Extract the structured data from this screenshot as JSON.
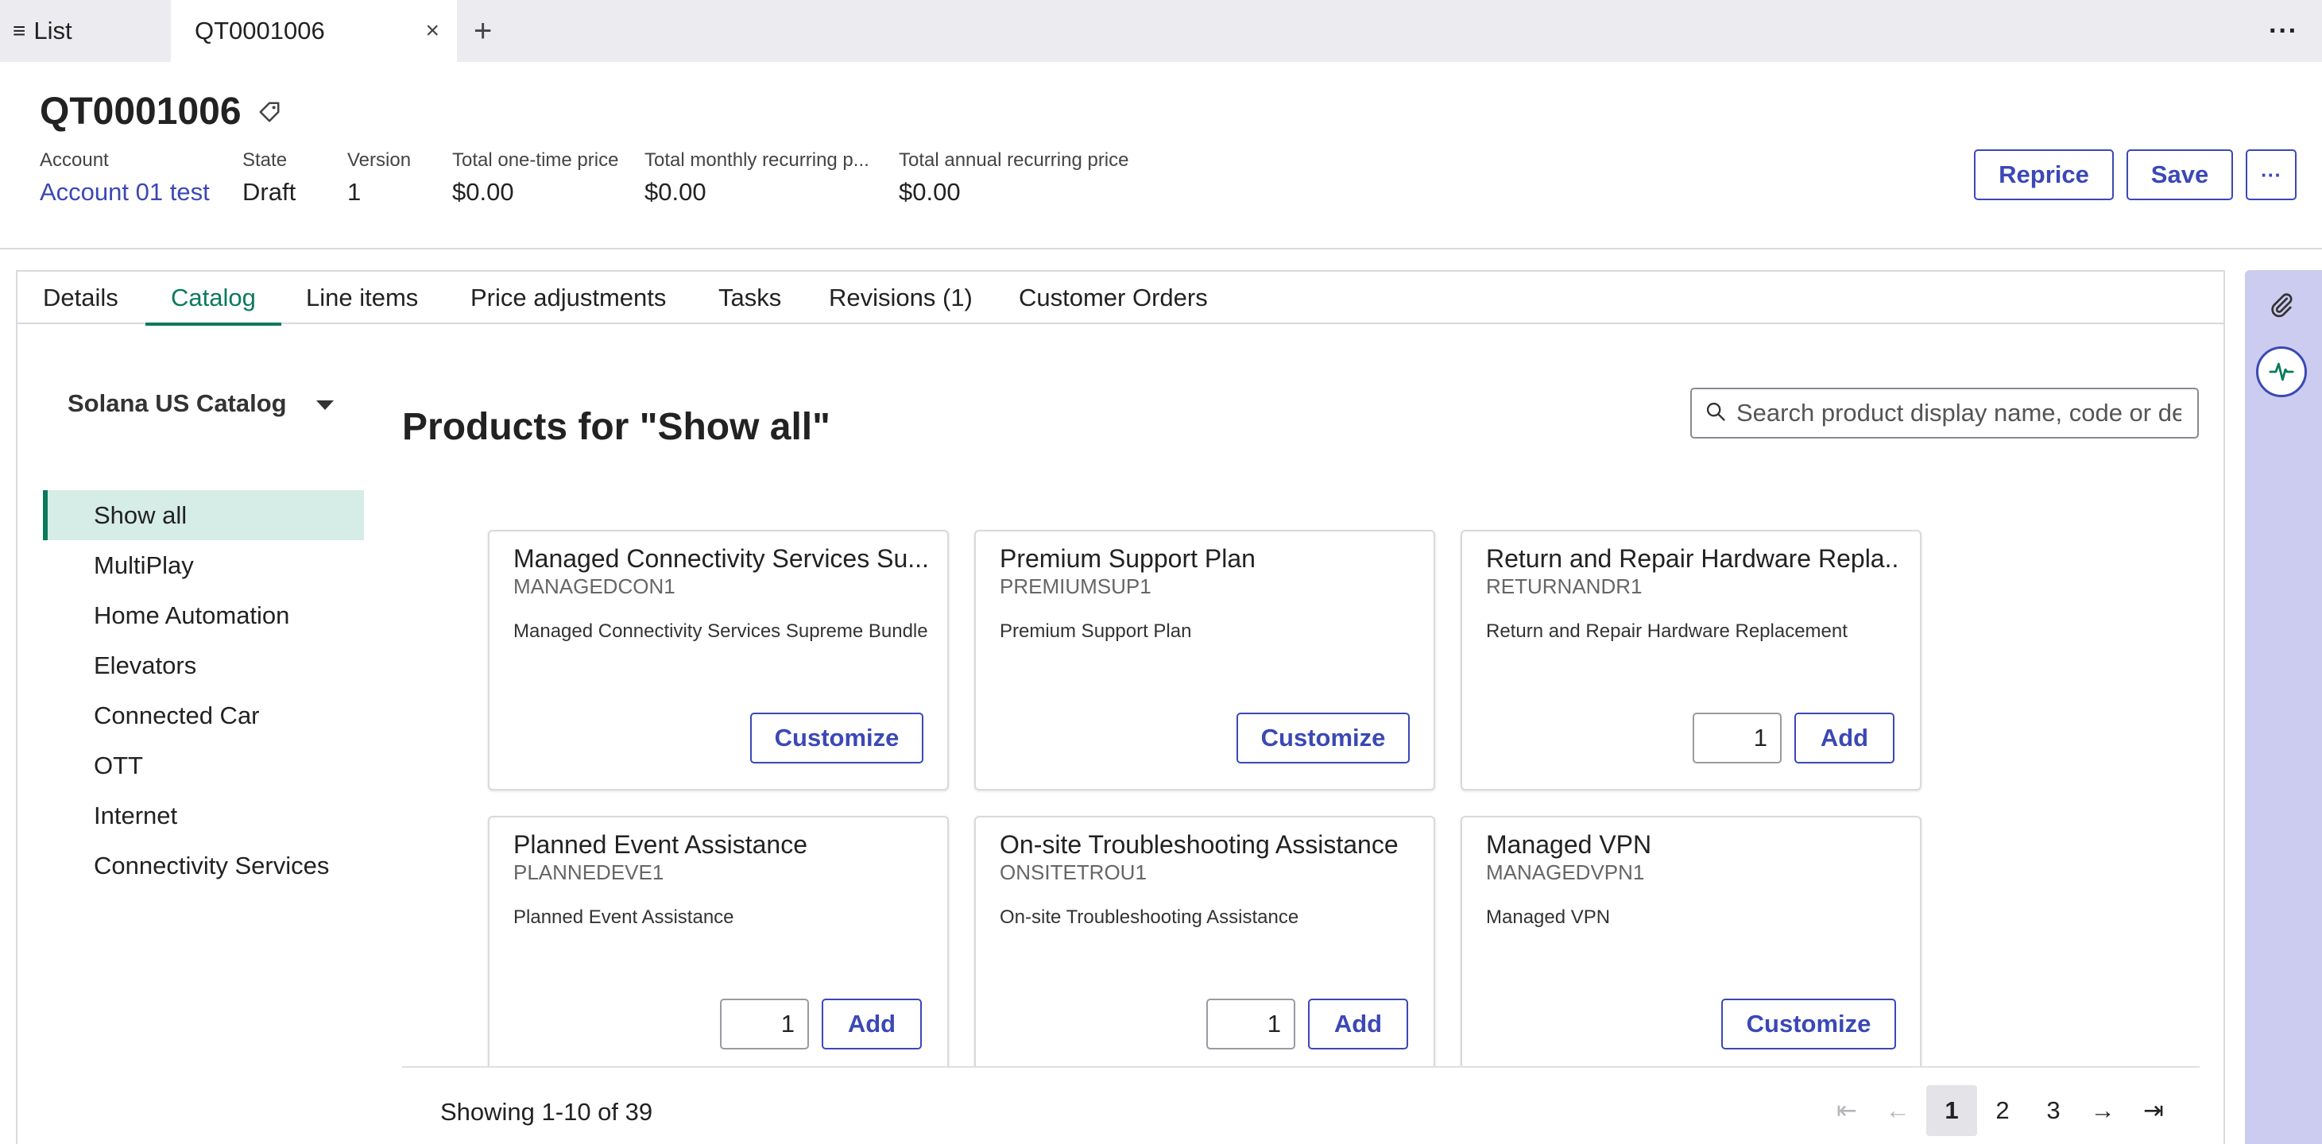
{
  "tabbar": {
    "list_label": "List",
    "doc_tab_label": "QT0001006",
    "close_glyph": "×",
    "add_glyph": "+",
    "more_glyph": "···"
  },
  "header": {
    "title": "QT0001006",
    "fields": {
      "account": {
        "label": "Account",
        "value": "Account 01 test"
      },
      "state": {
        "label": "State",
        "value": "Draft"
      },
      "version": {
        "label": "Version",
        "value": "1"
      },
      "one_time": {
        "label": "Total one-time price",
        "value": "$0.00"
      },
      "monthly": {
        "label": "Total monthly recurring p...",
        "value": "$0.00"
      },
      "annual": {
        "label": "Total annual recurring price",
        "value": "$0.00"
      }
    },
    "buttons": {
      "reprice": "Reprice",
      "save": "Save",
      "more": "···"
    }
  },
  "tabs": [
    "Details",
    "Catalog",
    "Line items",
    "Price adjustments",
    "Tasks",
    "Revisions (1)",
    "Customer Orders"
  ],
  "active_tab": "Catalog",
  "catalog": {
    "selected": "Solana US Catalog",
    "categories": [
      "Show all",
      "MultiPlay",
      "Home Automation",
      "Elevators",
      "Connected Car",
      "OTT",
      "Internet",
      "Connectivity Services"
    ],
    "active_category": "Show all"
  },
  "products": {
    "title": "Products for \"Show all\"",
    "search_placeholder": "Search product display name, code or de",
    "items": [
      {
        "name": "Managed Connectivity Services Su...",
        "code": "MANAGEDCON1",
        "desc": "Managed Connectivity Services Supreme Bundle",
        "action": "Customize"
      },
      {
        "name": "Premium Support Plan",
        "code": "PREMIUMSUP1",
        "desc": "Premium Support Plan",
        "action": "Customize"
      },
      {
        "name": "Return and Repair Hardware Repla...",
        "code": "RETURNANDR1",
        "desc": "Return and Repair Hardware Replacement",
        "action": "Add",
        "qty": "1"
      },
      {
        "name": "Planned Event Assistance",
        "code": "PLANNEDEVE1",
        "desc": "Planned Event Assistance",
        "action": "Add",
        "qty": "1"
      },
      {
        "name": "On-site Troubleshooting Assistance",
        "code": "ONSITETROU1",
        "desc": "On-site Troubleshooting Assistance",
        "action": "Add",
        "qty": "1"
      },
      {
        "name": "Managed VPN",
        "code": "MANAGEDVPN1",
        "desc": "Managed VPN",
        "action": "Customize"
      }
    ]
  },
  "pagination": {
    "showing": "Showing 1-10 of 39",
    "pages": [
      "1",
      "2",
      "3"
    ],
    "current": "1",
    "first_glyph": "⇤",
    "prev_glyph": "←",
    "next_glyph": "→",
    "last_glyph": "⇥"
  },
  "colors": {
    "accent": "#3b48b5",
    "active_tab": "#0b7a5c",
    "active_category_bg": "#d6ece6",
    "rail": "#ccccf0"
  }
}
